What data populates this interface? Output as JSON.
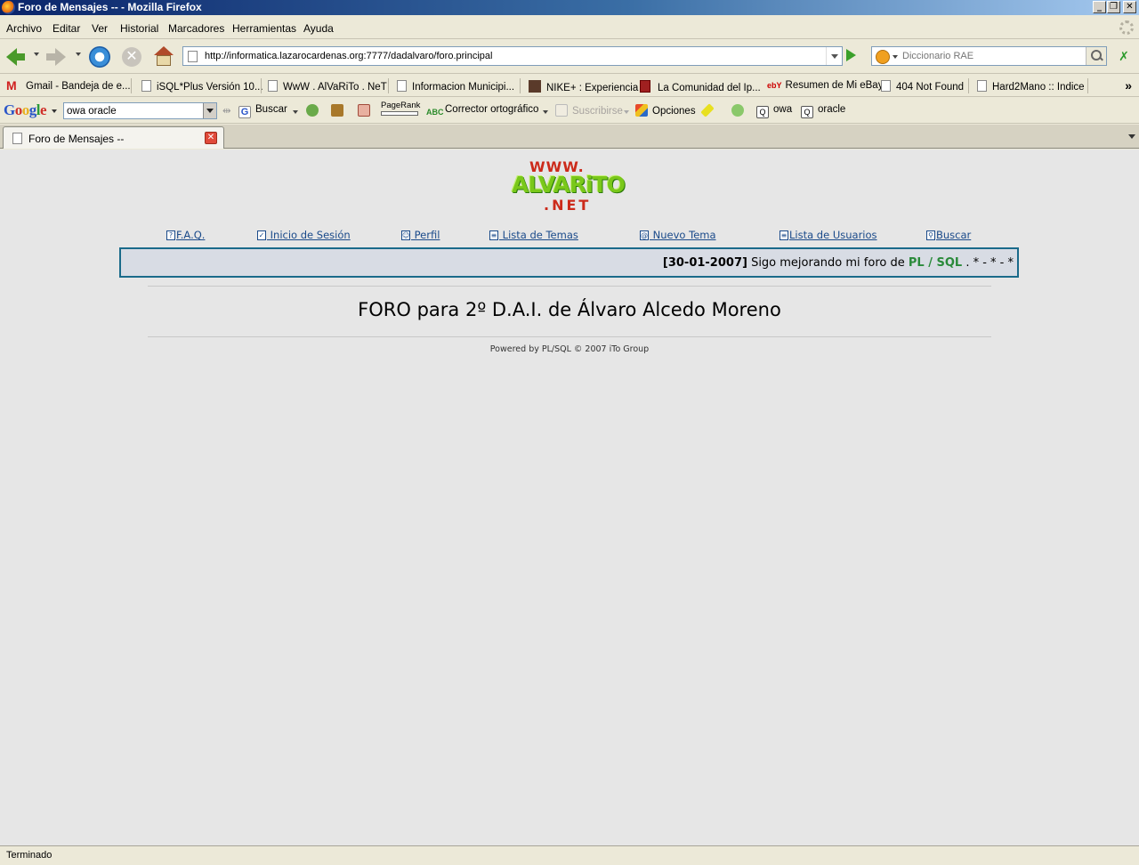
{
  "window": {
    "title": "Foro de Mensajes -- - Mozilla Firefox",
    "controls": {
      "minimize": "_",
      "restore": "❐",
      "close": "✕"
    }
  },
  "menubar": {
    "items": [
      "Archivo",
      "Editar",
      "Ver",
      "Historial",
      "Marcadores",
      "Herramientas",
      "Ayuda"
    ]
  },
  "navbar": {
    "url": "http://informatica.lazarocardenas.org:7777/dadalvaro/foro.principal",
    "search_placeholder": "Diccionario RAE"
  },
  "bookmarks": [
    "Gmail - Bandeja de e...",
    "iSQL*Plus Versión 10...",
    "WwW . AlVaRiTo . NeT",
    "Informacion Municipi...",
    "NIKE+ : Experiencia",
    "La Comunidad del Ip...",
    "Resumen de Mi eBay",
    "404 Not Found",
    "Hard2Mano :: Indice"
  ],
  "google_toolbar": {
    "logo": [
      "G",
      "o",
      "o",
      "g",
      "l",
      "e"
    ],
    "query": "owa oracle",
    "search_label": "Buscar",
    "pagerank_label": "PageRank",
    "spell_label": "Corrector ortográfico",
    "subscribe_label": "Suscribirse",
    "options_label": "Opciones",
    "term1": "owa",
    "term2": "oracle"
  },
  "tab": {
    "title": "Foro de Mensajes --",
    "close": "✕"
  },
  "page": {
    "logo": {
      "line1": "WWW.",
      "line2": "ALVARiTO",
      "line3": ".NET"
    },
    "nav": [
      {
        "icon": "?",
        "label": "F.A.Q."
      },
      {
        "icon": "✓",
        "label": " Inicio de Sesión"
      },
      {
        "icon": "☺",
        "label": " Perfil"
      },
      {
        "icon": "≡",
        "label": " Lista de Temas"
      },
      {
        "icon": "@",
        "label": " Nuevo Tema"
      },
      {
        "icon": "≡",
        "label": "Lista de Usuarios"
      },
      {
        "icon": "⚲",
        "label": "Buscar"
      }
    ],
    "marquee": {
      "date": "[30-01-2007]",
      "text": " Sigo mejorando mi foro de ",
      "pl": "PL",
      "slash": " / ",
      "sql": "SQL",
      "tail": " . * - * - *"
    },
    "title": "FORO para 2º D.A.I. de Álvaro Alcedo Moreno",
    "powered": "Powered by PL/SQL © 2007 iTo Group"
  },
  "status": {
    "text": "Terminado"
  }
}
